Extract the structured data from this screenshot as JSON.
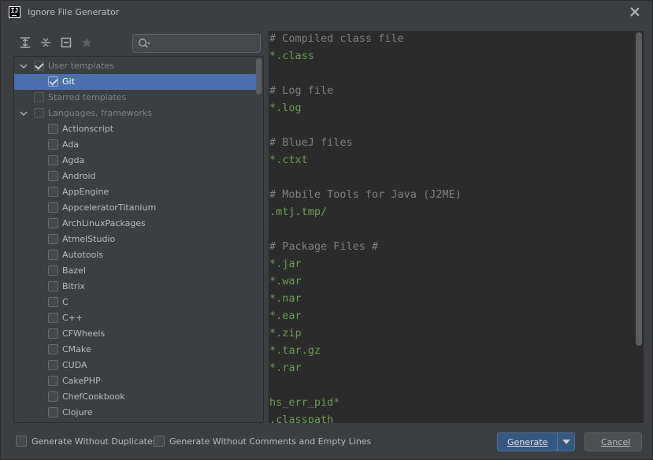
{
  "window": {
    "title": "Ignore File Generator",
    "app_icon_text": "IJ"
  },
  "toolbar": {
    "buttons": [
      "expand-all-icon",
      "collapse-all-icon",
      "uncheck-all-icon",
      "star-icon"
    ],
    "search_value": ""
  },
  "tree": {
    "user_templates": {
      "label": "User templates",
      "checked": true,
      "expanded": true
    },
    "git": {
      "label": "Git",
      "checked": true,
      "selected": true
    },
    "starred_templates": {
      "label": "Starred templates",
      "checked": false
    },
    "languages": {
      "label": "Languages, frameworks",
      "checked": false,
      "expanded": true
    },
    "items": [
      "Actionscript",
      "Ada",
      "Agda",
      "Android",
      "AppEngine",
      "AppceleratorTitanium",
      "ArchLinuxPackages",
      "AtmelStudio",
      "Autotools",
      "Bazel",
      "Bitrix",
      "C",
      "C++",
      "CFWheels",
      "CMake",
      "CUDA",
      "CakePHP",
      "ChefCookbook",
      "Clojure"
    ]
  },
  "editor": {
    "lines": [
      {
        "text": "# Compiled class file",
        "kind": "comment"
      },
      {
        "text": "*.class",
        "kind": "pattern"
      },
      {
        "text": "",
        "kind": "blank"
      },
      {
        "text": "# Log file",
        "kind": "comment"
      },
      {
        "text": "*.log",
        "kind": "pattern"
      },
      {
        "text": "",
        "kind": "blank"
      },
      {
        "text": "# BlueJ files",
        "kind": "comment"
      },
      {
        "text": "*.ctxt",
        "kind": "pattern"
      },
      {
        "text": "",
        "kind": "blank"
      },
      {
        "text": "# Mobile Tools for Java (J2ME)",
        "kind": "comment"
      },
      {
        "text": ".mtj.tmp/",
        "kind": "pattern"
      },
      {
        "text": "",
        "kind": "blank"
      },
      {
        "text": "# Package Files #",
        "kind": "comment"
      },
      {
        "text": "*.jar",
        "kind": "pattern"
      },
      {
        "text": "*.war",
        "kind": "pattern"
      },
      {
        "text": "*.nar",
        "kind": "pattern"
      },
      {
        "text": "*.ear",
        "kind": "pattern"
      },
      {
        "text": "*.zip",
        "kind": "pattern"
      },
      {
        "text": "*.tar.gz",
        "kind": "pattern"
      },
      {
        "text": "*.rar",
        "kind": "pattern"
      },
      {
        "text": "",
        "kind": "blank"
      },
      {
        "text": "hs_err_pid*",
        "kind": "pattern"
      },
      {
        "text": ".classpath",
        "kind": "pattern"
      }
    ]
  },
  "footer": {
    "no_duplicates_label": "Generate Without Duplicates",
    "no_comments_label": "Generate Without Comments and Empty Lines",
    "generate_label": "Generate",
    "cancel_label": "Cancel"
  },
  "colors": {
    "background": "#3c3f41",
    "editor_background": "#2b2b2b",
    "selection": "#4b6eaf",
    "comment": "#808080",
    "pattern": "#6a9f53",
    "primary_button": "#365880"
  }
}
